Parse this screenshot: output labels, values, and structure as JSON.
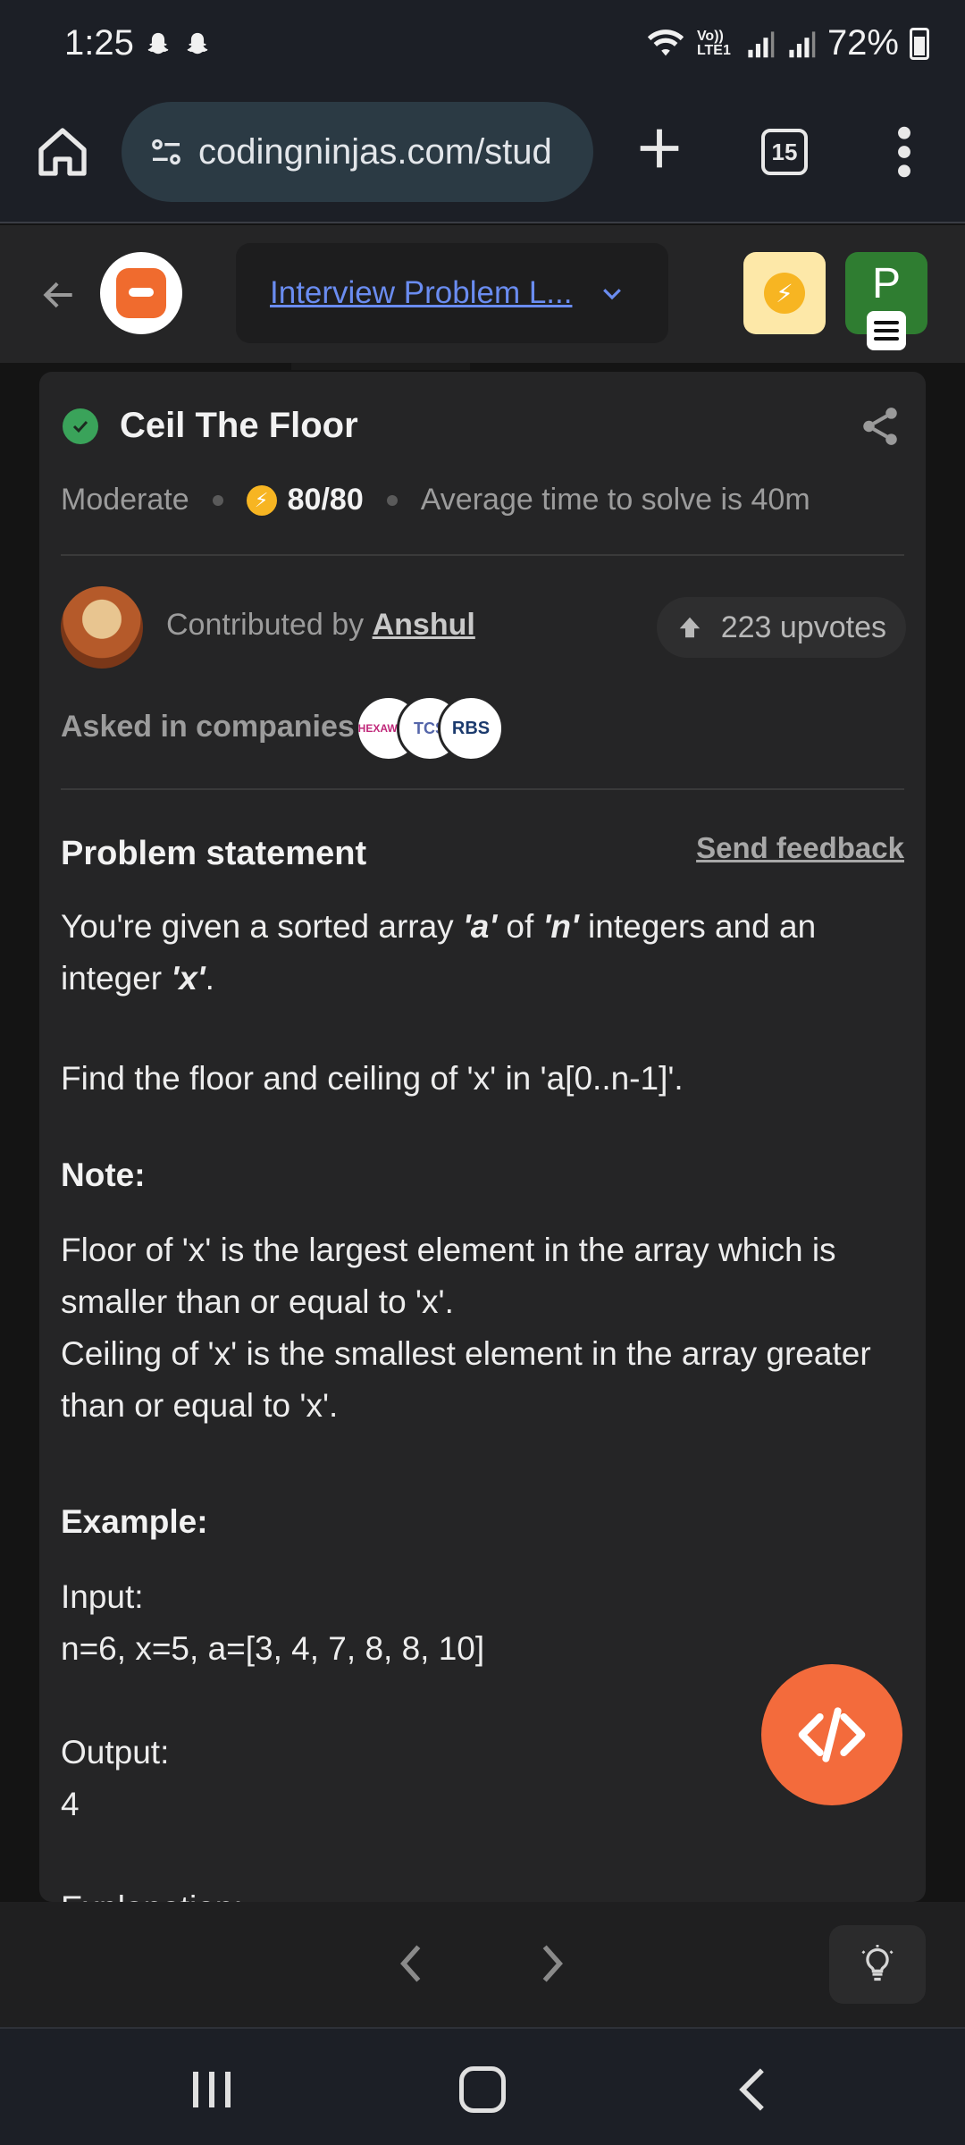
{
  "status_bar": {
    "time": "1:25",
    "network_label": "Vo)) LTE1",
    "battery": "72%"
  },
  "browser": {
    "url": "codingninjas.com/stud",
    "tab_count": "15"
  },
  "app_header": {
    "dropdown_label": "Interview Problem L...",
    "profile_initial": "P"
  },
  "problem": {
    "title": "Ceil The Floor",
    "difficulty": "Moderate",
    "score": "80/80",
    "avg_time": "Average time to solve is 40m",
    "contributed_by_label": "Contributed by",
    "contributor": "Anshul",
    "upvotes": "223 upvotes",
    "asked_label": "Asked in companies",
    "companies": [
      "HEXAWARE",
      "TCS",
      "RBS"
    ]
  },
  "statement": {
    "heading": "Problem statement",
    "feedback": "Send feedback",
    "intro_1": "You're given a sorted array ",
    "intro_var_a": "'a'",
    "intro_2": " of ",
    "intro_var_n": "'n'",
    "intro_3": " integers and an integer ",
    "intro_var_x": "'x'",
    "intro_4": ".",
    "find": "Find the floor and ceiling of 'x' in 'a[0..n-1]'.",
    "note_heading": "Note:",
    "note_1": "Floor of 'x' is the largest element in the array which is smaller than or equal to 'x'.",
    "note_2": "Ceiling of 'x' is the smallest element in the array greater than or equal to 'x'.",
    "example_heading": "Example:",
    "input_label": "Input:",
    "input_value": "n=6, x=5, a=[3, 4, 7, 8, 8, 10]",
    "output_label": "Output:",
    "output_value": "4",
    "explanation_label": "Explanation:"
  },
  "colors": {
    "accent_orange": "#f36b3c",
    "link_blue": "#6a8cf0",
    "solved_green": "#3aa35a"
  }
}
